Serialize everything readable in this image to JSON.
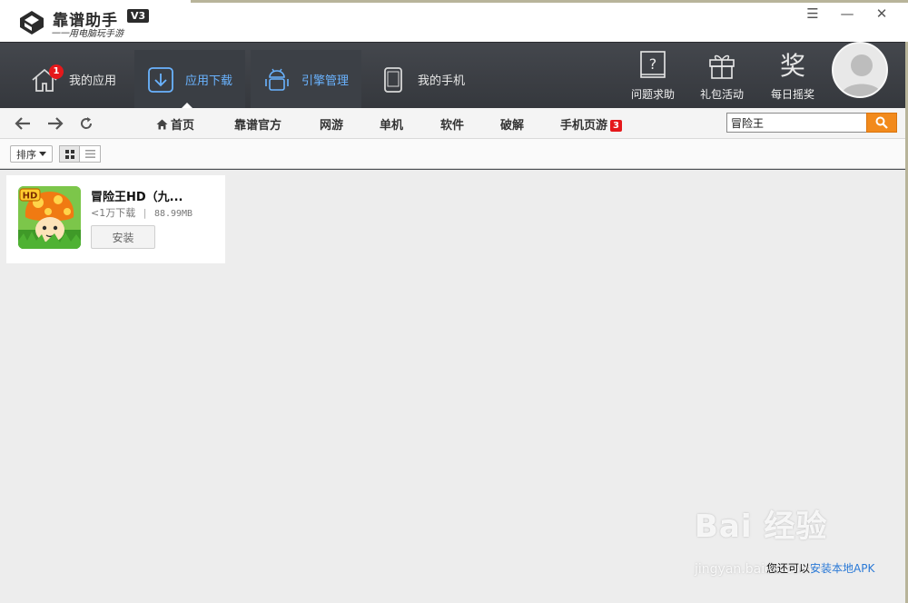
{
  "app": {
    "name": "靠谱助手",
    "version": "V3",
    "slogan": "一一用电脑玩手游"
  },
  "window_controls": [
    "☰",
    "—",
    "✕"
  ],
  "main_nav": [
    {
      "label": "我的应用",
      "icon": "home-icon",
      "badge": "1"
    },
    {
      "label": "应用下载",
      "icon": "download-icon",
      "active": true
    },
    {
      "label": "引擎管理",
      "icon": "android-icon"
    },
    {
      "label": "我的手机",
      "icon": "phone-icon"
    }
  ],
  "tools": [
    {
      "label": "问题求助",
      "icon": "help-book-icon"
    },
    {
      "label": "礼包活动",
      "icon": "gift-icon"
    },
    {
      "label": "每日摇奖",
      "icon": "lottery-icon"
    }
  ],
  "categories": [
    "首页",
    "靠谱官方",
    "网游",
    "单机",
    "软件",
    "破解",
    "手机页游"
  ],
  "mobile_web_games_badge": "3",
  "search": {
    "value": "冒险王"
  },
  "toolbar": {
    "sort_label": "排序"
  },
  "results": [
    {
      "title": "冒险王HD（九...",
      "downloads": "<1万下载",
      "size": "88.99MB",
      "install_label": "安装",
      "icon_badge": "HD"
    }
  ],
  "footer": {
    "prefix": "您还可以",
    "link": "安装本地APK"
  },
  "watermark": {
    "brand": "Bai 经验",
    "url": "jingyan.baidu.com"
  },
  "colors": {
    "accent": "#6ab3ff",
    "search_button": "#f28a1c",
    "badge": "#e5181b",
    "link": "#2a79d6"
  }
}
